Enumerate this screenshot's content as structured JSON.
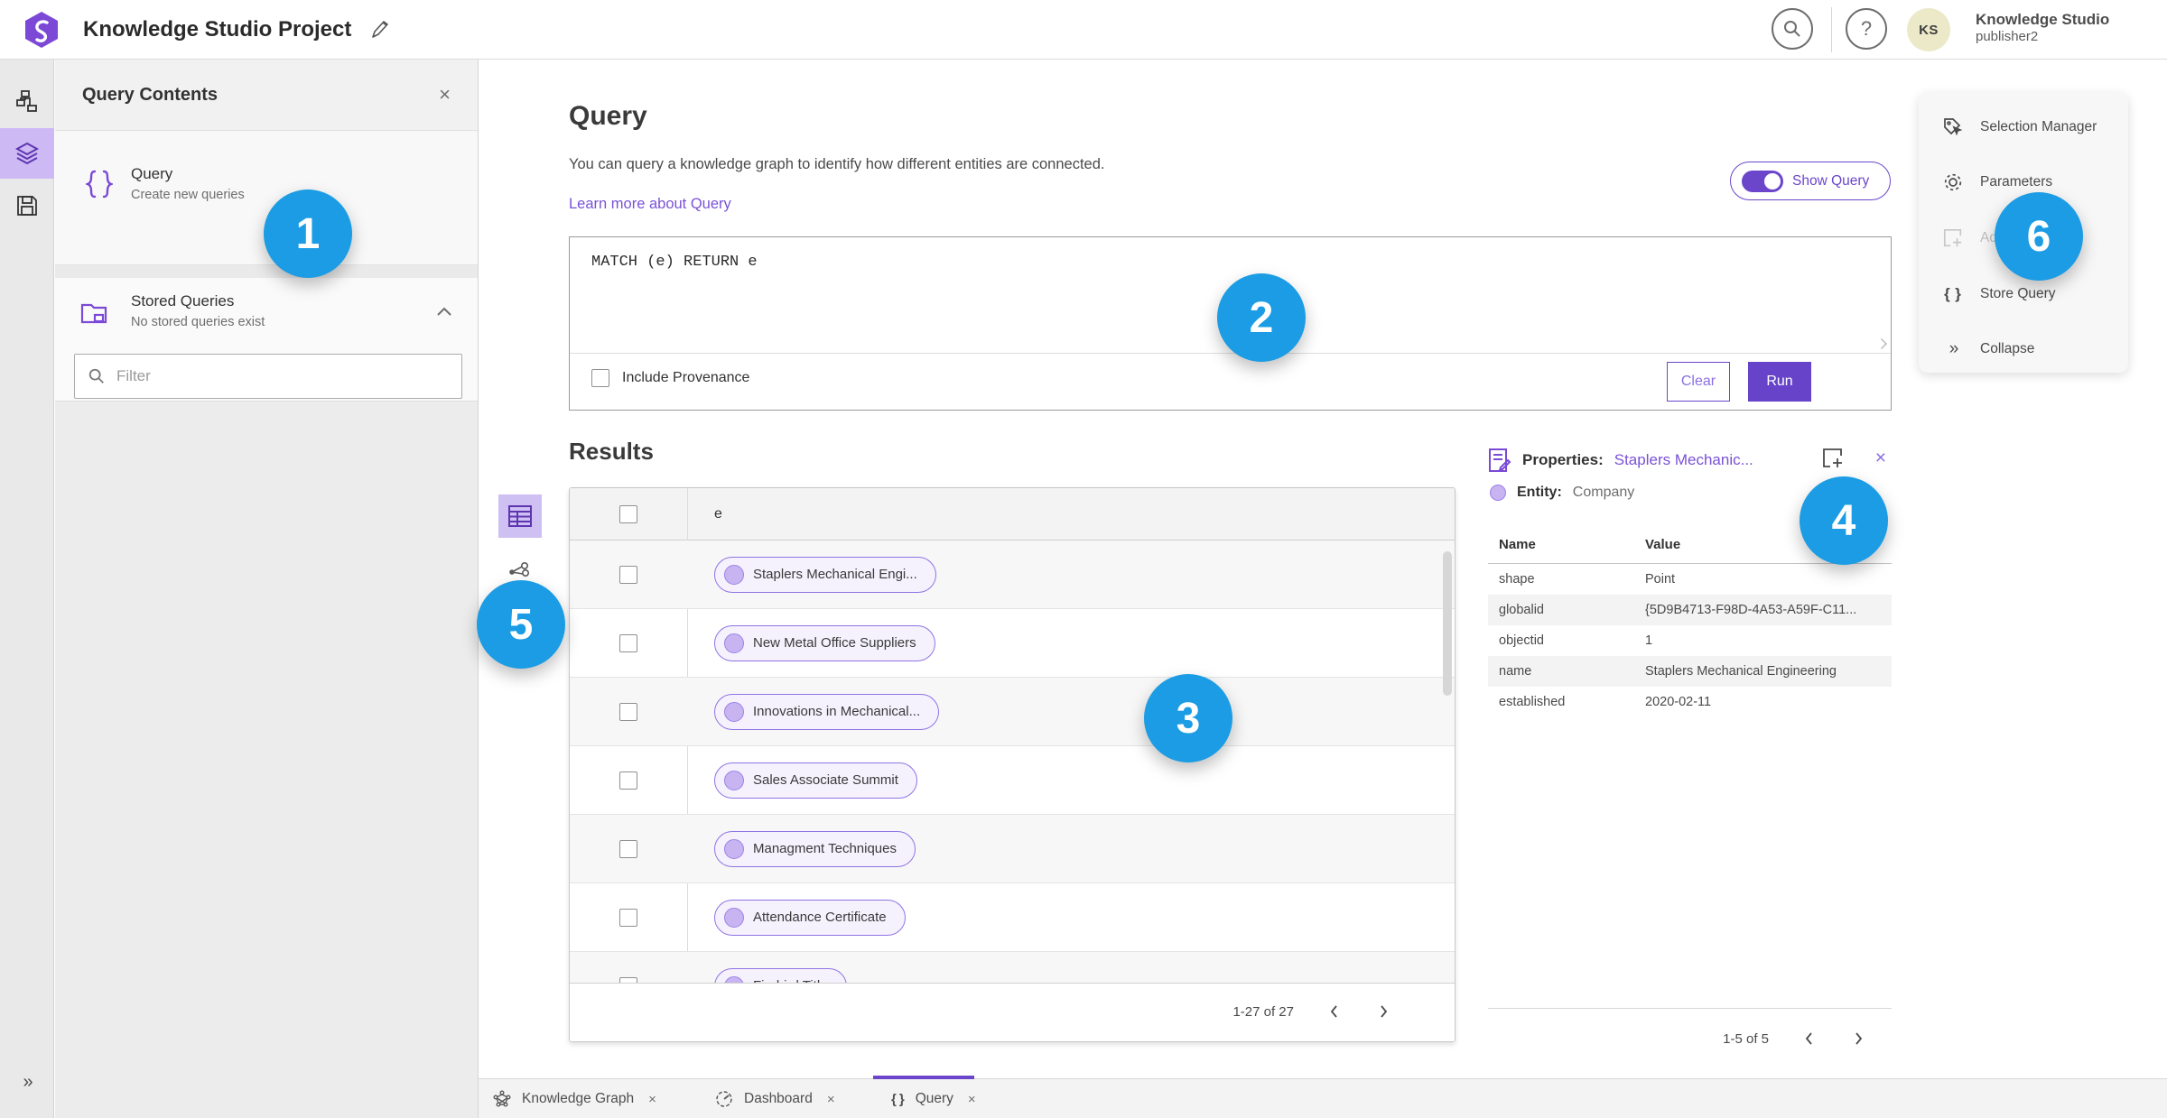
{
  "topbar": {
    "title": "Knowledge Studio Project",
    "app_name": "Knowledge Studio",
    "user_name": "publisher2",
    "avatar_initials": "KS"
  },
  "left_panel": {
    "title": "Query Contents",
    "close": "×",
    "query_item": {
      "title": "Query",
      "subtitle": "Create new queries"
    },
    "stored_item": {
      "title": "Stored Queries",
      "subtitle": "No stored queries exist"
    },
    "filter_placeholder": "Filter"
  },
  "query_section": {
    "heading": "Query",
    "description": "You can query a knowledge graph to identify how different entities are connected.",
    "link": "Learn more about Query",
    "toggle_label": "Show Query",
    "query_text": "MATCH (e) RETURN e",
    "include_provenance": "Include Provenance",
    "clear": "Clear",
    "run": "Run"
  },
  "results": {
    "heading": "Results",
    "column": "e",
    "rows": [
      "Staplers Mechanical Engi...",
      "New Metal Office Suppliers",
      "Innovations in Mechanical...",
      "Sales Associate Summit",
      "Managment Techniques",
      "Attendance Certificate",
      "Firebird Title"
    ],
    "pagination": "1-27 of 27"
  },
  "properties": {
    "label": "Properties:",
    "entity_link": "Staplers Mechanic...",
    "entity_label": "Entity:",
    "entity_type": "Company",
    "col_name": "Name",
    "col_value": "Value",
    "rows": [
      {
        "name": "shape",
        "value": "Point"
      },
      {
        "name": "globalid",
        "value": "{5D9B4713-F98D-4A53-A59F-C11..."
      },
      {
        "name": "objectid",
        "value": "1"
      },
      {
        "name": "name",
        "value": "Staplers Mechanical Engineering"
      },
      {
        "name": "established",
        "value": "2020-02-11"
      }
    ],
    "pagination": "1-5 of 5"
  },
  "right_menu": {
    "items": [
      {
        "label": "Selection Manager",
        "disabled": false
      },
      {
        "label": "Parameters",
        "disabled": false
      },
      {
        "label": "Add To Map",
        "disabled": true
      },
      {
        "label": "Store Query",
        "disabled": false
      },
      {
        "label": "Collapse",
        "disabled": false
      }
    ]
  },
  "tabs": [
    {
      "label": "Knowledge Graph"
    },
    {
      "label": "Dashboard"
    },
    {
      "label": "Query"
    }
  ],
  "badges": [
    "1",
    "2",
    "3",
    "4",
    "5",
    "6"
  ],
  "colors": {
    "accent_purple": "#6b46cb",
    "link_purple": "#7a52d6",
    "pill_border": "#8f74e4",
    "pill_fill": "#f5f2fd",
    "active_lavender": "#cdb9f4",
    "badge_blue": "#1b9ce4",
    "avatar_bg": "#ece9c9"
  }
}
